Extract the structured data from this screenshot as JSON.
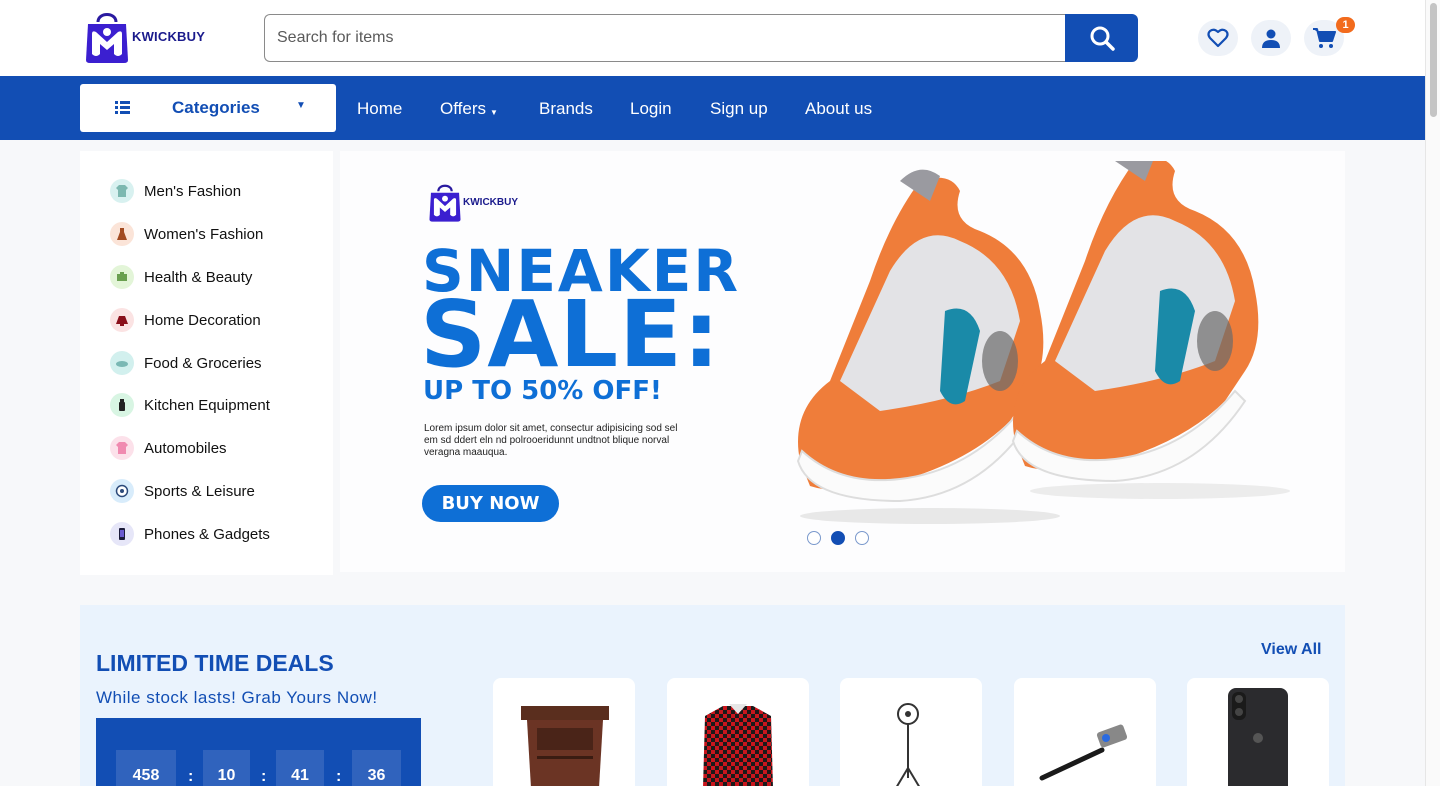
{
  "brand": {
    "name": "KWICKBUY"
  },
  "search": {
    "placeholder": "Search for items"
  },
  "header_icons": [
    "heart-icon",
    "user-icon",
    "cart-icon"
  ],
  "cart": {
    "count": "1"
  },
  "nav": {
    "categories_label": "Categories",
    "items": [
      {
        "label": "Home"
      },
      {
        "label": "Offers"
      },
      {
        "label": "Brands"
      },
      {
        "label": "Login"
      },
      {
        "label": "Sign up"
      },
      {
        "label": "About us"
      }
    ]
  },
  "sidebar": {
    "items": [
      {
        "label": "Men's Fashion",
        "icon": "shirt-icon"
      },
      {
        "label": "Women's Fashion",
        "icon": "dress-icon"
      },
      {
        "label": "Health & Beauty",
        "icon": "cosmetics-icon"
      },
      {
        "label": "Home Decoration",
        "icon": "lamp-icon"
      },
      {
        "label": "Food & Groceries",
        "icon": "food-icon"
      },
      {
        "label": "Kitchen Equipment",
        "icon": "bottle-icon"
      },
      {
        "label": "Automobiles",
        "icon": "car-icon"
      },
      {
        "label": "Sports & Leisure",
        "icon": "ball-icon"
      },
      {
        "label": "Phones & Gadgets",
        "icon": "phone-icon"
      }
    ]
  },
  "banner": {
    "logo_text": "KWICKBUY",
    "title_line1": "SNEAKER",
    "title_line2": "SALE:",
    "subtitle": "UP TO 50% OFF!",
    "body": "Lorem ipsum dolor sit amet, consectur adipisicing sod sel em sd ddert eln nd polrooeridunnt undtnot blique norval veragna maauqua.",
    "button": "BUY NOW",
    "slides": 3,
    "active_slide": 2
  },
  "deals": {
    "title": "LIMITED TIME DEALS",
    "subtitle": "While stock lasts! Grab Yours Now!",
    "view_all": "View All",
    "timer": {
      "days": "458",
      "hours": "10",
      "minutes": "41",
      "seconds": "36",
      "separator": ":"
    },
    "products": [
      "nightstand",
      "plaid-shirt",
      "ring-light",
      "selfie-stick",
      "smartphone"
    ]
  },
  "colors": {
    "primary": "#124eb4",
    "banner_blue": "#0e6fd6",
    "badge": "#f26b1d",
    "deals_bg": "#eaf3fd"
  }
}
